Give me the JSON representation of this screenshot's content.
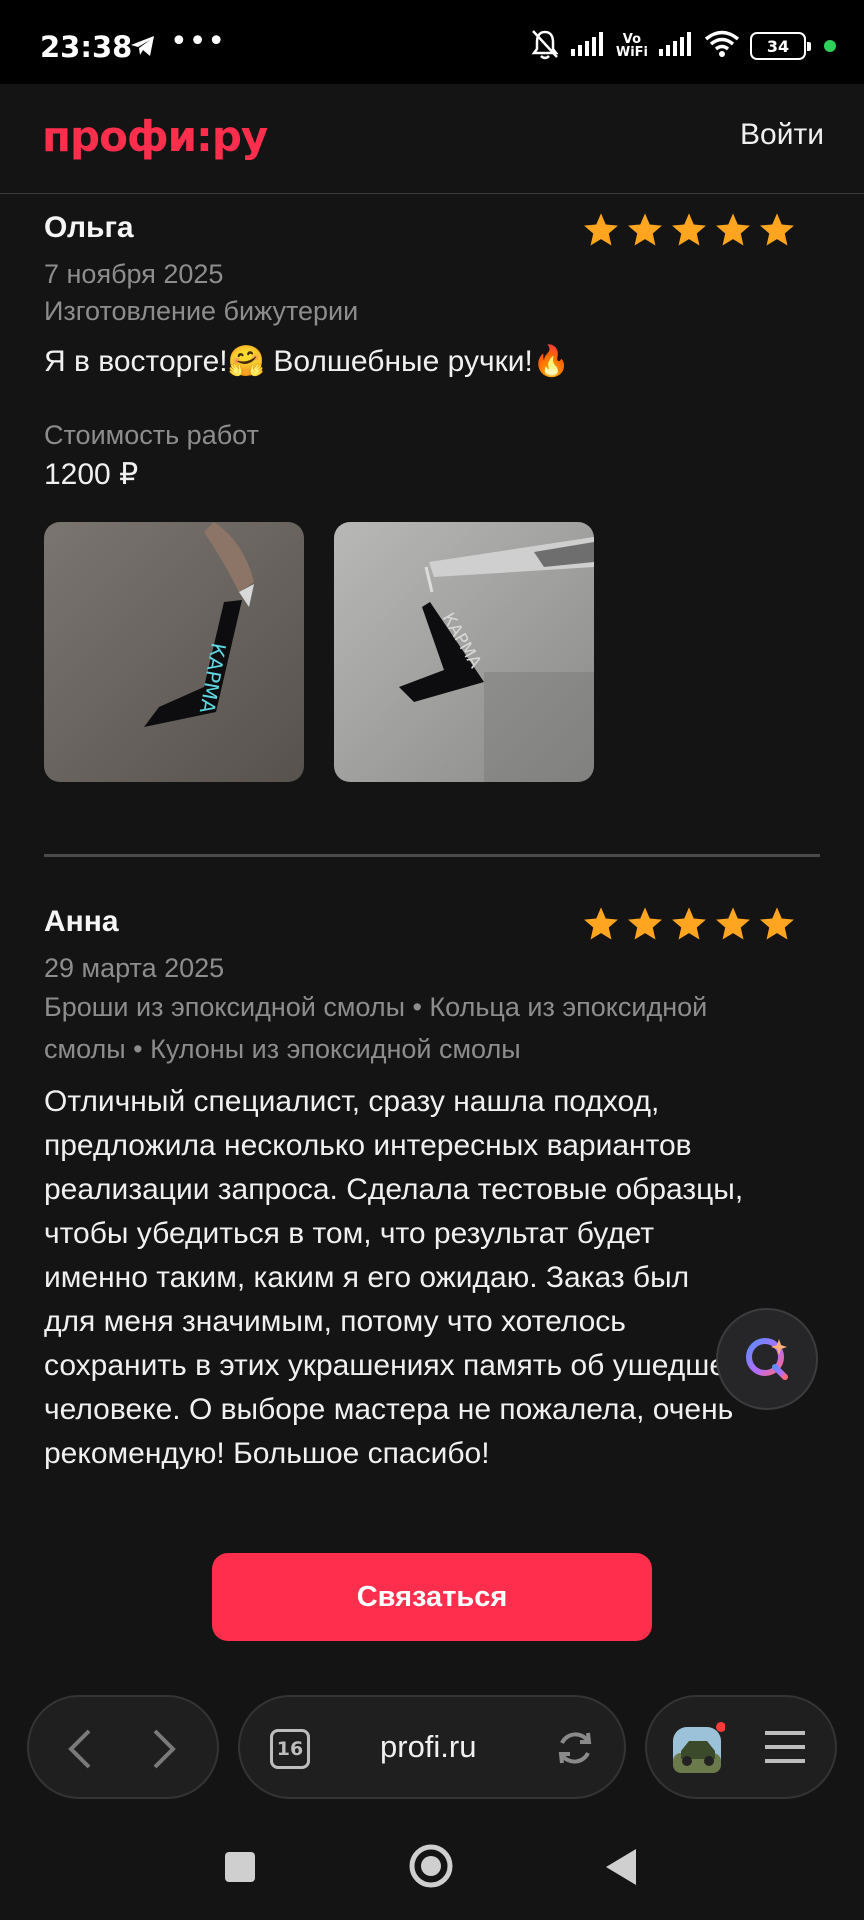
{
  "status_bar": {
    "time": "23:38",
    "dots": "•••",
    "vowifi_line1": "Vo",
    "vowifi_line2": "WiFi",
    "battery": "34",
    "icons": [
      "telegram-icon",
      "mute-bell-icon",
      "signal-icon",
      "wifi-icon",
      "battery-icon"
    ]
  },
  "header": {
    "logo": "профи:ру",
    "login": "Войти"
  },
  "reviews": [
    {
      "name": "Ольга",
      "rating": 5,
      "date": "7 ноября 2025",
      "category": "Изготовление бижутерии",
      "text": "Я в восторге!🤗 Волшебные ручки!🔥",
      "cost_label": "Стоимость работ",
      "cost": "1200 ₽",
      "photos": [
        "resin-boomerang-pendant-photo-1",
        "resin-boomerang-pendant-photo-2"
      ]
    },
    {
      "name": "Анна",
      "rating": 5,
      "date": "29 марта 2025",
      "category_line1": "Броши из эпоксидной смолы • Кольца из эпоксидной",
      "category_line2": "смолы • Кулоны из эпоксидной смолы",
      "text_lines": [
        "Отличный специалист, сразу нашла подход,",
        "предложила несколько интересных вариантов",
        "реализации запроса. Сделала тестовые образцы,",
        "чтобы убедиться в том, что результат будет",
        "именно таким, каким я его ожидаю. Заказ был",
        "для меня значимым, потому что хотелось",
        "сохранить в этих украшениях память об ушедшем",
        "человеке. О выборе мастера не пожалела, очень",
        "рекомендую! Большое спасибо!"
      ]
    }
  ],
  "contact_button": "Связаться",
  "browser": {
    "url": "profi.ru",
    "tab_count": "16"
  },
  "colors": {
    "accent": "#ff2e4c",
    "star": "#ffa51f",
    "background": "#141414",
    "muted_text": "#8d8d8d"
  }
}
